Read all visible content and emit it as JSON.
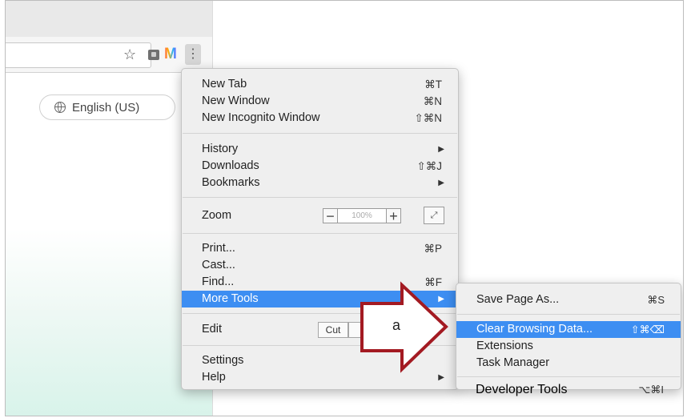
{
  "browser": {
    "toolbar_icons": [
      "star-icon",
      "extension-icon",
      "m-extension-icon",
      "kebab-menu-icon"
    ],
    "language_button": {
      "label": "English (US)",
      "icon": "globe-icon"
    }
  },
  "menu": {
    "group1": [
      {
        "label": "New Tab",
        "shortcut": "⌘T"
      },
      {
        "label": "New Window",
        "shortcut": "⌘N"
      },
      {
        "label": "New Incognito Window",
        "shortcut": "⇧⌘N"
      }
    ],
    "group2": [
      {
        "label": "History",
        "arrow": "▶"
      },
      {
        "label": "Downloads",
        "shortcut": "⇧⌘J"
      },
      {
        "label": "Bookmarks",
        "arrow": "▶"
      }
    ],
    "zoom": {
      "label": "Zoom",
      "minus": "−",
      "value": "100%",
      "plus": "+",
      "fullscreen": "⤢"
    },
    "group4": [
      {
        "label": "Print...",
        "shortcut": "⌘P"
      },
      {
        "label": "Cast..."
      },
      {
        "label": "Find...",
        "shortcut": "⌘F"
      },
      {
        "label": "More Tools",
        "arrow": "▶"
      }
    ],
    "edit": {
      "label": "Edit",
      "cut": "Cut"
    },
    "group6": [
      {
        "label": "Settings"
      },
      {
        "label": "Help",
        "arrow": "▶"
      }
    ]
  },
  "submenu": {
    "items": [
      {
        "label": "Save Page As...",
        "shortcut": "⌘S"
      },
      {
        "label": "Clear Browsing Data...",
        "shortcut": "⇧⌘⌫"
      },
      {
        "label": "Extensions"
      },
      {
        "label": "Task Manager"
      },
      {
        "label": "Developer Tools",
        "shortcut": "⌥⌘I"
      }
    ]
  },
  "callout": {
    "label": "a",
    "color": "#a31a22"
  },
  "colors": {
    "highlight": "#3d8ef2",
    "menu_bg": "#efefef"
  }
}
